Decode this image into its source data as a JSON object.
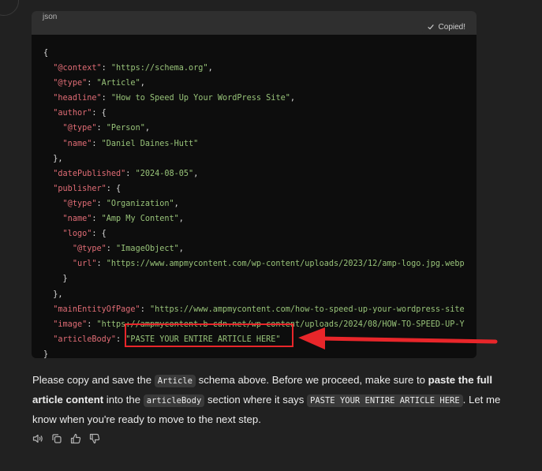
{
  "code_block": {
    "language": "json",
    "copy_status": "Copied!",
    "lines": [
      [
        {
          "t": "p",
          "v": "{"
        }
      ],
      [
        {
          "t": "p",
          "v": "  "
        },
        {
          "t": "k",
          "v": "\"@context\""
        },
        {
          "t": "p",
          "v": ": "
        },
        {
          "t": "s",
          "v": "\"https://schema.org\""
        },
        {
          "t": "p",
          "v": ","
        }
      ],
      [
        {
          "t": "p",
          "v": "  "
        },
        {
          "t": "k",
          "v": "\"@type\""
        },
        {
          "t": "p",
          "v": ": "
        },
        {
          "t": "s",
          "v": "\"Article\""
        },
        {
          "t": "p",
          "v": ","
        }
      ],
      [
        {
          "t": "p",
          "v": "  "
        },
        {
          "t": "k",
          "v": "\"headline\""
        },
        {
          "t": "p",
          "v": ": "
        },
        {
          "t": "s",
          "v": "\"How to Speed Up Your WordPress Site\""
        },
        {
          "t": "p",
          "v": ","
        }
      ],
      [
        {
          "t": "p",
          "v": "  "
        },
        {
          "t": "k",
          "v": "\"author\""
        },
        {
          "t": "p",
          "v": ": {"
        }
      ],
      [
        {
          "t": "p",
          "v": "    "
        },
        {
          "t": "k",
          "v": "\"@type\""
        },
        {
          "t": "p",
          "v": ": "
        },
        {
          "t": "s",
          "v": "\"Person\""
        },
        {
          "t": "p",
          "v": ","
        }
      ],
      [
        {
          "t": "p",
          "v": "    "
        },
        {
          "t": "k",
          "v": "\"name\""
        },
        {
          "t": "p",
          "v": ": "
        },
        {
          "t": "s",
          "v": "\"Daniel Daines-Hutt\""
        }
      ],
      [
        {
          "t": "p",
          "v": "  },"
        }
      ],
      [
        {
          "t": "p",
          "v": "  "
        },
        {
          "t": "k",
          "v": "\"datePublished\""
        },
        {
          "t": "p",
          "v": ": "
        },
        {
          "t": "s",
          "v": "\"2024-08-05\""
        },
        {
          "t": "p",
          "v": ","
        }
      ],
      [
        {
          "t": "p",
          "v": "  "
        },
        {
          "t": "k",
          "v": "\"publisher\""
        },
        {
          "t": "p",
          "v": ": {"
        }
      ],
      [
        {
          "t": "p",
          "v": "    "
        },
        {
          "t": "k",
          "v": "\"@type\""
        },
        {
          "t": "p",
          "v": ": "
        },
        {
          "t": "s",
          "v": "\"Organization\""
        },
        {
          "t": "p",
          "v": ","
        }
      ],
      [
        {
          "t": "p",
          "v": "    "
        },
        {
          "t": "k",
          "v": "\"name\""
        },
        {
          "t": "p",
          "v": ": "
        },
        {
          "t": "s",
          "v": "\"Amp My Content\""
        },
        {
          "t": "p",
          "v": ","
        }
      ],
      [
        {
          "t": "p",
          "v": "    "
        },
        {
          "t": "k",
          "v": "\"logo\""
        },
        {
          "t": "p",
          "v": ": {"
        }
      ],
      [
        {
          "t": "p",
          "v": "      "
        },
        {
          "t": "k",
          "v": "\"@type\""
        },
        {
          "t": "p",
          "v": ": "
        },
        {
          "t": "s",
          "v": "\"ImageObject\""
        },
        {
          "t": "p",
          "v": ","
        }
      ],
      [
        {
          "t": "p",
          "v": "      "
        },
        {
          "t": "k",
          "v": "\"url\""
        },
        {
          "t": "p",
          "v": ": "
        },
        {
          "t": "s",
          "v": "\"https://www.ampmycontent.com/wp-content/uploads/2023/12/amp-logo.jpg.webp"
        }
      ],
      [
        {
          "t": "p",
          "v": "    }"
        }
      ],
      [
        {
          "t": "p",
          "v": "  },"
        }
      ],
      [
        {
          "t": "p",
          "v": "  "
        },
        {
          "t": "k",
          "v": "\"mainEntityOfPage\""
        },
        {
          "t": "p",
          "v": ": "
        },
        {
          "t": "s",
          "v": "\"https://www.ampmycontent.com/how-to-speed-up-your-wordpress-site"
        }
      ],
      [
        {
          "t": "p",
          "v": "  "
        },
        {
          "t": "k",
          "v": "\"image\""
        },
        {
          "t": "p",
          "v": ": "
        },
        {
          "t": "s",
          "v": "\"https://ampmycontent.b-cdn.net/wp-content/uploads/2024/08/HOW-TO-SPEED-UP-Y"
        }
      ],
      [
        {
          "t": "p",
          "v": "  "
        },
        {
          "t": "k",
          "v": "\"articleBody\""
        },
        {
          "t": "p",
          "v": ": "
        },
        {
          "t": "s",
          "v": "\"PASTE YOUR ENTIRE ARTICLE HERE\""
        }
      ],
      [
        {
          "t": "p",
          "v": "}"
        }
      ]
    ]
  },
  "message": {
    "p1": "Please copy and save the ",
    "code1": "Article",
    "p2": " schema above. Before we proceed, make sure to ",
    "bold": "paste the full article content",
    "p3": " into the ",
    "code2": "articleBody",
    "p4": " section where it says ",
    "code3": "PASTE YOUR ENTIRE ARTICLE HERE",
    "p5": ". Let me know when you're ready to move to the next step."
  },
  "actions": [
    "read-aloud-icon",
    "copy-icon",
    "thumbs-up-icon",
    "thumbs-down-icon"
  ],
  "colors": {
    "background": "#212121",
    "code_bg": "#0d0d0d",
    "key": "#e06c75",
    "string": "#98c379",
    "annotation_red": "#e8262a"
  }
}
